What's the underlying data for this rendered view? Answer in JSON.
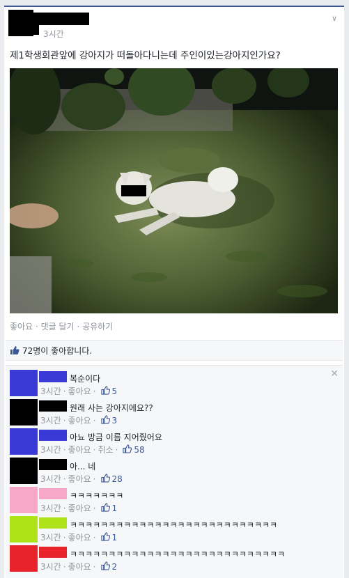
{
  "post": {
    "time": "3시간",
    "text": "제1학생회관앞에 강아지가 떠돌아다니는데 주인이있는강아지인가요?",
    "chevron": "∨",
    "actions": {
      "like": "좋아요",
      "sep": "·",
      "comment": "댓글 달기",
      "share": "공유하기"
    },
    "likes_summary": "72명이 좋아합니다."
  },
  "colors": {
    "brand": "#3b5998",
    "meta_grey": "#90949c"
  },
  "comments": [
    {
      "text": "복순이다",
      "time": "3시간",
      "like": "좋아요",
      "extra": "",
      "count": "5",
      "avatar_color": "#3939d6",
      "name_color": "#3939d6"
    },
    {
      "text": "원래 사는 강아지에요??",
      "time": "3시간",
      "like": "좋아요",
      "extra": "",
      "count": "3",
      "avatar_color": "#000000",
      "name_color": "#000000"
    },
    {
      "text": "아뇨 방금 이름 지어줬어요",
      "time": "3시간",
      "like": "좋아요",
      "extra": "취소",
      "count": "58",
      "avatar_color": "#3939d6",
      "name_color": "#3939d6"
    },
    {
      "text": "아... 네",
      "time": "3시간",
      "like": "좋아요",
      "extra": "",
      "count": "28",
      "avatar_color": "#000000",
      "name_color": "#000000"
    },
    {
      "text": "ㅋㅋㅋㅋㅋㅋㅋ",
      "time": "3시간",
      "like": "좋아요",
      "extra": "",
      "count": "1",
      "avatar_color": "#f7a8c8",
      "name_color": "#f7a8c8"
    },
    {
      "text": "ㅋㅋㅋㅋㅋㅋㅋㅋㅋㅋㅋㅋㅋㅋㅋㅋㅋㅋㅋㅋㅋㅋㅋㅋㅋㅋㅋ",
      "time": "3시간",
      "like": "좋아요",
      "extra": "",
      "count": "1",
      "avatar_color": "#b0e21a",
      "name_color": "#b0e21a"
    },
    {
      "text": "ㅋㅋㅋㅋㅋㅋㅋㅋㅋㅋㅋㅋㅋㅋㅋㅋㅋㅋㅋㅋㅋㅋㅋㅋㅋㅋㅋㅋ",
      "time": "3시간",
      "like": "좋아요",
      "extra": "",
      "count": "2",
      "avatar_color": "#e8232a",
      "name_color": "#e8232a"
    }
  ]
}
